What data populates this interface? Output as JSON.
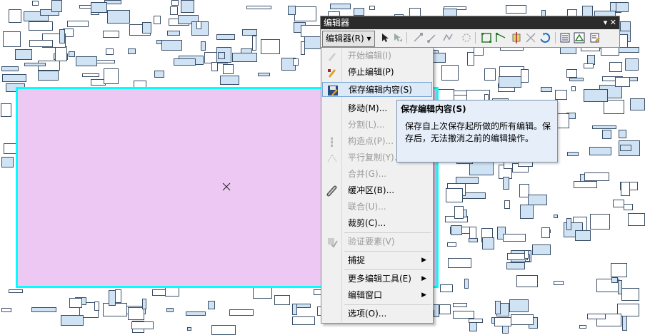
{
  "toolbar": {
    "title": "编辑器",
    "window_controls": "▾ ✕",
    "editor_menu_label": "编辑器(R) ▾",
    "icons": [
      "edit-tool-icon",
      "edit-annotation-icon",
      "straight-segment-icon",
      "endpoint-arc-icon",
      "trace-icon",
      "point-icon",
      "edit-vertices-icon",
      "reshape-icon",
      "cut-polygon-icon",
      "split-icon",
      "rotate-icon",
      "attributes-icon",
      "sketch-properties-icon",
      "create-features-icon"
    ]
  },
  "menu": {
    "items": [
      {
        "label": "开始编辑(I)",
        "enabled": false,
        "icon": "start-editing-icon"
      },
      {
        "label": "停止编辑(P)",
        "enabled": true,
        "icon": "stop-editing-icon"
      },
      {
        "label": "保存编辑内容(S)",
        "enabled": true,
        "icon": "save-edits-icon",
        "highlighted": true
      },
      {
        "label": "移动(M)...",
        "enabled": true
      },
      {
        "label": "分割(L)...",
        "enabled": false
      },
      {
        "label": "构造点(P)...",
        "enabled": false,
        "icon": "construct-points-icon"
      },
      {
        "label": "平行复制(Y)...",
        "enabled": false,
        "icon": "copy-parallel-icon"
      },
      {
        "label": "合并(G)...",
        "enabled": false
      },
      {
        "label": "缓冲区(B)...",
        "enabled": true,
        "icon": "buffer-icon"
      },
      {
        "label": "联合(U)...",
        "enabled": false
      },
      {
        "label": "裁剪(C)...",
        "enabled": true
      },
      {
        "label": "验证要素(V)",
        "enabled": false,
        "icon": "validate-features-icon"
      },
      {
        "label": "捕捉",
        "enabled": true,
        "submenu": true
      },
      {
        "label": "更多编辑工具(E)",
        "enabled": true,
        "submenu": true
      },
      {
        "label": "编辑窗口",
        "enabled": true,
        "submenu": true
      },
      {
        "label": "选项(O)...",
        "enabled": true
      }
    ]
  },
  "tooltip": {
    "title": "保存编辑内容(S)",
    "body": "保存自上次保存起所做的所有编辑。保存后，无法撤消之前的编辑操作。"
  },
  "colors": {
    "selected_fill": "#ecc8f2",
    "selection_outline": "#00ffff",
    "building_fill": "#cfe3f4",
    "building_outline": "#3a4f68"
  }
}
